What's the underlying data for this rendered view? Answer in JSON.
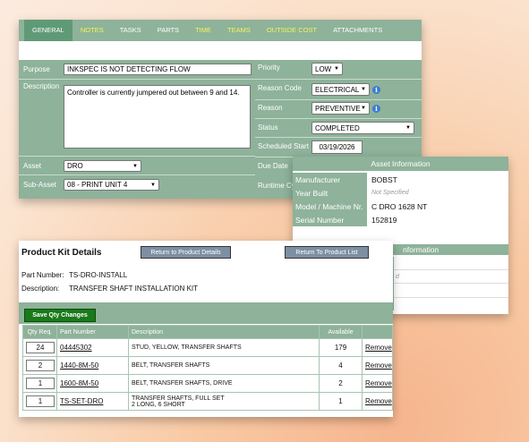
{
  "work_order": {
    "tabs": [
      {
        "label": "GENERAL"
      },
      {
        "label": "NOTES"
      },
      {
        "label": "TASKS"
      },
      {
        "label": "PARTS"
      },
      {
        "label": "TIME"
      },
      {
        "label": "TEAMS"
      },
      {
        "label": "OUTSIDE COST"
      },
      {
        "label": "ATTACHMENTS"
      }
    ],
    "purpose_label": "Purpose",
    "purpose_value": "INKSPEC IS NOT DETECTING FLOW",
    "description_label": "Description",
    "description_value": "Controller is currently jumpered out between 9 and 14.",
    "asset_label": "Asset",
    "asset_value": "DRO",
    "subasset_label": "Sub-Asset",
    "subasset_value": "08 - PRINT UNIT 4",
    "priority_label": "Priority",
    "priority_value": "LOW",
    "reason_code_label": "Reason Code",
    "reason_code_value": "ELECTRICAL",
    "reason_label": "Reason",
    "reason_value": "PREVENTIVE",
    "status_label": "Status",
    "status_value": "COMPLETED",
    "scheduled_label": "Scheduled Start",
    "scheduled_value": "03/19/2026",
    "due_label": "Due Date",
    "runtime_label": "Runtime Cy"
  },
  "asset_info": {
    "title": "Asset Information",
    "second_title": "nformation",
    "rows": [
      {
        "label": "Manufacturer",
        "value": "BOBST"
      },
      {
        "label": "Year Built",
        "value": "Not Specified"
      },
      {
        "label": "Model / Machine Nr.",
        "value": "C DRO 1628 NT"
      },
      {
        "label": "Serial Number",
        "value": "152819"
      }
    ],
    "partial_text": "d"
  },
  "kit": {
    "title": "Product Kit Details",
    "btn_return_details": "Return to Product Details",
    "btn_return_list": "Return To Product List",
    "part_number_label": "Part Number:",
    "part_number_value": "TS-DRO-INSTALL",
    "description_label": "Description:",
    "description_value": "TRANSFER SHAFT INSTALLATION KIT",
    "save_label": "Save Qty Changes",
    "columns": [
      "Qty Req.",
      "Part Number",
      "Description",
      "Available",
      ""
    ],
    "rows": [
      {
        "qty": "24",
        "part": "04445302",
        "desc": "STUD, YELLOW, TRANSFER SHAFTS",
        "desc2": "",
        "avail": "179",
        "remove": "Remove"
      },
      {
        "qty": "2",
        "part": "1440-8M-50",
        "desc": "BELT, TRANSFER SHAFTS",
        "desc2": "",
        "avail": "4",
        "remove": "Remove"
      },
      {
        "qty": "1",
        "part": "1600-8M-50",
        "desc": "BELT, TRANSFER SHAFTS, DRIVE",
        "desc2": "",
        "avail": "2",
        "remove": "Remove"
      },
      {
        "qty": "1",
        "part": "TS-SET-DRO",
        "desc": "TRANSFER SHAFTS, FULL SET",
        "desc2": "2 LONG, 6 SHORT",
        "avail": "1",
        "remove": "Remove"
      }
    ]
  },
  "colors": {
    "panel_green": "#8eb29a",
    "active_tab": "#5f9a76",
    "tab_highlight": "#f1f75a",
    "save_button": "#1a7a1a",
    "nav_button": "#7d8fa3",
    "info_icon": "#3b7bd6"
  }
}
